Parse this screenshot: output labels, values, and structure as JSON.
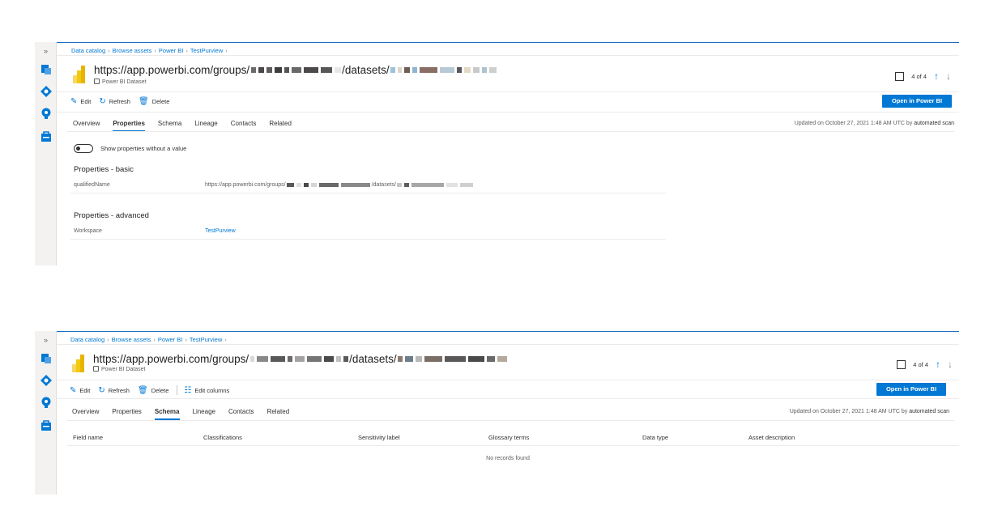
{
  "rail": {
    "expand_label": "»"
  },
  "breadcrumb": [
    "Data catalog",
    "Browse assets",
    "Power BI",
    "TestPurview"
  ],
  "asset": {
    "title_prefix": "https://app.powerbi.com/groups/",
    "title_mid": "/datasets/",
    "subtitle": "Power BI Dataset"
  },
  "nav": {
    "count": "4 of 4"
  },
  "toolbar": {
    "edit": "Edit",
    "refresh": "Refresh",
    "delete": "Delete",
    "edit_columns": "Edit columns",
    "open_button": "Open in Power BI"
  },
  "tabs": [
    "Overview",
    "Properties",
    "Schema",
    "Lineage",
    "Contacts",
    "Related"
  ],
  "updated": {
    "prefix": "Updated on October 27, 2021 1:48 AM UTC by",
    "who": "automated scan"
  },
  "properties": {
    "toggle_label": "Show properties without a value",
    "basic_heading": "Properties - basic",
    "qualified_key": "qualifiedName",
    "qualified_prefix": "https://app.powerbi.com/groups/",
    "qualified_mid": "/datasets/",
    "advanced_heading": "Properties - advanced",
    "workspace_key": "Workspace",
    "workspace_value": "TestPurview"
  },
  "schema": {
    "columns": [
      "Field name",
      "Classifications",
      "Sensitivity label",
      "Glossary terms",
      "Data type",
      "Asset description"
    ],
    "empty_text": "No records found"
  },
  "colors": {
    "accent": "#0078d4",
    "brand_yellow": "#f2c811"
  }
}
